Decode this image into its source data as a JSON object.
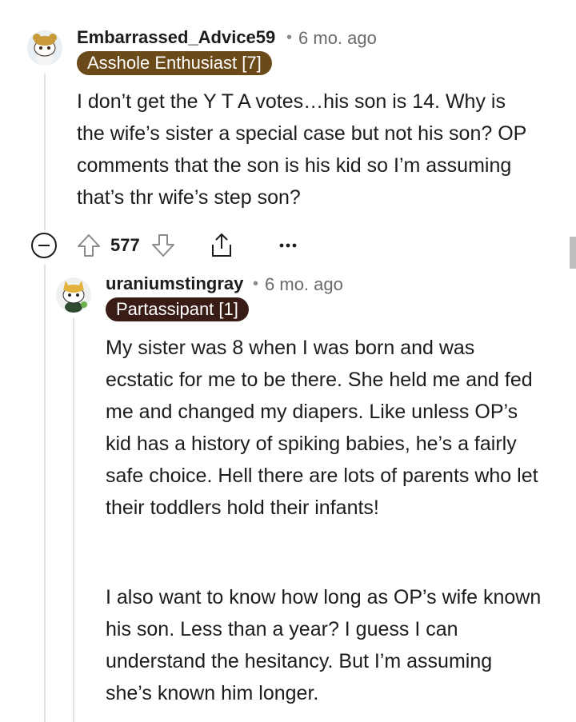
{
  "comments": [
    {
      "username": "Embarrassed_Advice59",
      "time": "6 mo. ago",
      "flair": "Asshole Enthusiast [7]",
      "flair_color": "#6b4a1a",
      "body": [
        "I don’t get the Y T A votes…his son is 14. Why is the wife’s sister a special case but not his son? OP comments that the son is his kid so I’m assuming that’s thr wife’s step son?"
      ],
      "score": "577"
    },
    {
      "username": "uraniumstingray",
      "time": "6 mo. ago",
      "flair": "Partassipant [1]",
      "flair_color": "#3a1c17",
      "body": [
        "My sister was 8 when I was born and was ecstatic for me to be there. She held me and fed me and changed my diapers. Like unless OP’s kid has a history of spiking babies, he’s a fairly safe choice. Hell there are lots of parents who let their toddlers hold their infants!",
        "I also want to know how long as OP’s wife known his son. Less than a year? I guess I can understand the hesitancy. But I’m assuming she’s known him longer."
      ]
    }
  ]
}
